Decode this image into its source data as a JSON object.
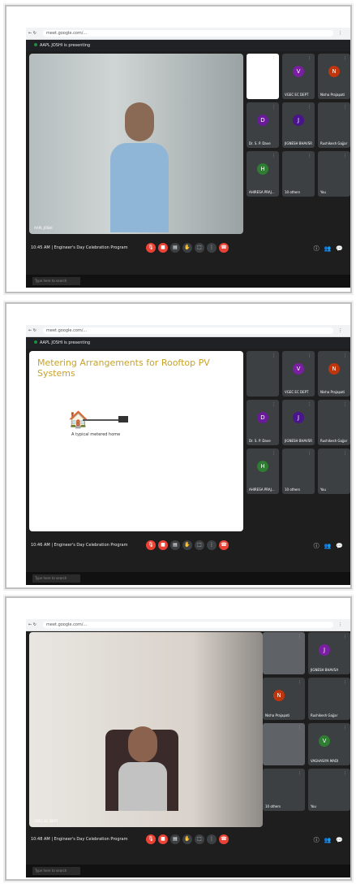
{
  "browser": {
    "url": "meet.google.com/..."
  },
  "frames": [
    {
      "presenting_label": "AAPL JOSHI is presenting",
      "stage_label": "AAPL JOSHI",
      "meeting": "10:45 AM | Engineer's Day Celebration Program",
      "tiles": [
        {
          "name": "",
          "initial": "",
          "color": "#ffffff"
        },
        {
          "name": "VGEC EC DEPT",
          "initial": "V",
          "color": "#7b1fa2"
        },
        {
          "name": "Nisha Prajapati",
          "initial": "N",
          "color": "#bf360c"
        },
        {
          "name": "Dr. S. P. Dave",
          "initial": "D",
          "color": "#6a1b9a"
        },
        {
          "name": "JIGNESH BHAVSR...",
          "initial": "J",
          "color": "#4a148c"
        },
        {
          "name": "Rushikesh Gajjar",
          "initial": "",
          "color": "#3c4043"
        },
        {
          "name": "AHIRESA PRAJ...",
          "initial": "H",
          "color": "#2e7d32"
        },
        {
          "name": "10 others",
          "initial": "",
          "color": "#3c4043"
        },
        {
          "name": "You",
          "initial": "",
          "color": "#3c4043"
        }
      ],
      "taskbar_search": "Type here to search"
    },
    {
      "presenting_label": "AAPL JOSHI is presenting",
      "slide_title": "Metering Arrangements for Rooftop PV Systems",
      "slide_caption": "A typical metered home",
      "meeting": "10:46 AM | Engineer's Day Celebration Program",
      "tiles": [
        {
          "name": "",
          "initial": "",
          "color": "#3c4043"
        },
        {
          "name": "VGEC EC DEPT",
          "initial": "V",
          "color": "#7b1fa2"
        },
        {
          "name": "Nisha Prajapati",
          "initial": "N",
          "color": "#bf360c"
        },
        {
          "name": "Dr. S. P. Dave",
          "initial": "D",
          "color": "#6a1b9a"
        },
        {
          "name": "JIGNESH BHAVSR...",
          "initial": "J",
          "color": "#4a148c"
        },
        {
          "name": "Rushikesh Gajjar",
          "initial": "",
          "color": "#3c4043"
        },
        {
          "name": "AHIRESA PRAJ...",
          "initial": "H",
          "color": "#2e7d32"
        },
        {
          "name": "10 others",
          "initial": "",
          "color": "#3c4043"
        },
        {
          "name": "You",
          "initial": "",
          "color": "#3c4043"
        }
      ],
      "taskbar_search": "Type here to search"
    },
    {
      "stage_label": "VGEC EC DEPT",
      "meeting": "10:48 AM | Engineer's Day Celebration Program",
      "tiles": [
        {
          "name": "",
          "initial": "",
          "color": "#5f6368"
        },
        {
          "name": "JIGNESH BHAVSAR",
          "initial": "J",
          "color": "#7b1fa2"
        },
        {
          "name": "Nisha Prajapati",
          "initial": "N",
          "color": "#bf360c"
        },
        {
          "name": "Rushikesh Gajjar",
          "initial": "",
          "color": "#3c4043"
        },
        {
          "name": "",
          "initial": "",
          "color": "#5f6368"
        },
        {
          "name": "VAGHASIYA MADHU",
          "initial": "V",
          "color": "#2e7d32"
        },
        {
          "name": "10 others",
          "initial": "",
          "color": "#3c4043"
        },
        {
          "name": "You",
          "initial": "",
          "color": "#3c4043"
        }
      ],
      "taskbar_search": "Type here to search"
    }
  ]
}
